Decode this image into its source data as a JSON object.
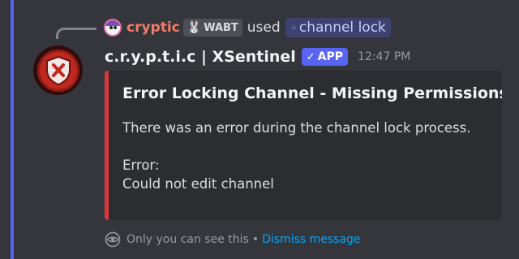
{
  "reply": {
    "username": "cryptic",
    "server_tag": "WABT",
    "used_text": "used",
    "command": "channel lock"
  },
  "message": {
    "bot_name": "c.r.y.p.t.i.c | XSentinel",
    "app_badge": "APP",
    "timestamp": "12:47 PM"
  },
  "embed": {
    "title": "Error Locking Channel - Missing Permissions",
    "description_line1": "There was an error during the channel lock process.",
    "description_line2": "Error:",
    "description_line3": "Could not edit channel",
    "accent_color": "#da373c"
  },
  "ephemeral": {
    "notice": "Only you can see this",
    "separator": "•",
    "dismiss_label": "Dismiss message"
  },
  "colors": {
    "mention_bar": "#5865f2",
    "reply_username": "#f47b67",
    "link": "#00a8fc",
    "command_chip_text": "#c9cdfb"
  }
}
